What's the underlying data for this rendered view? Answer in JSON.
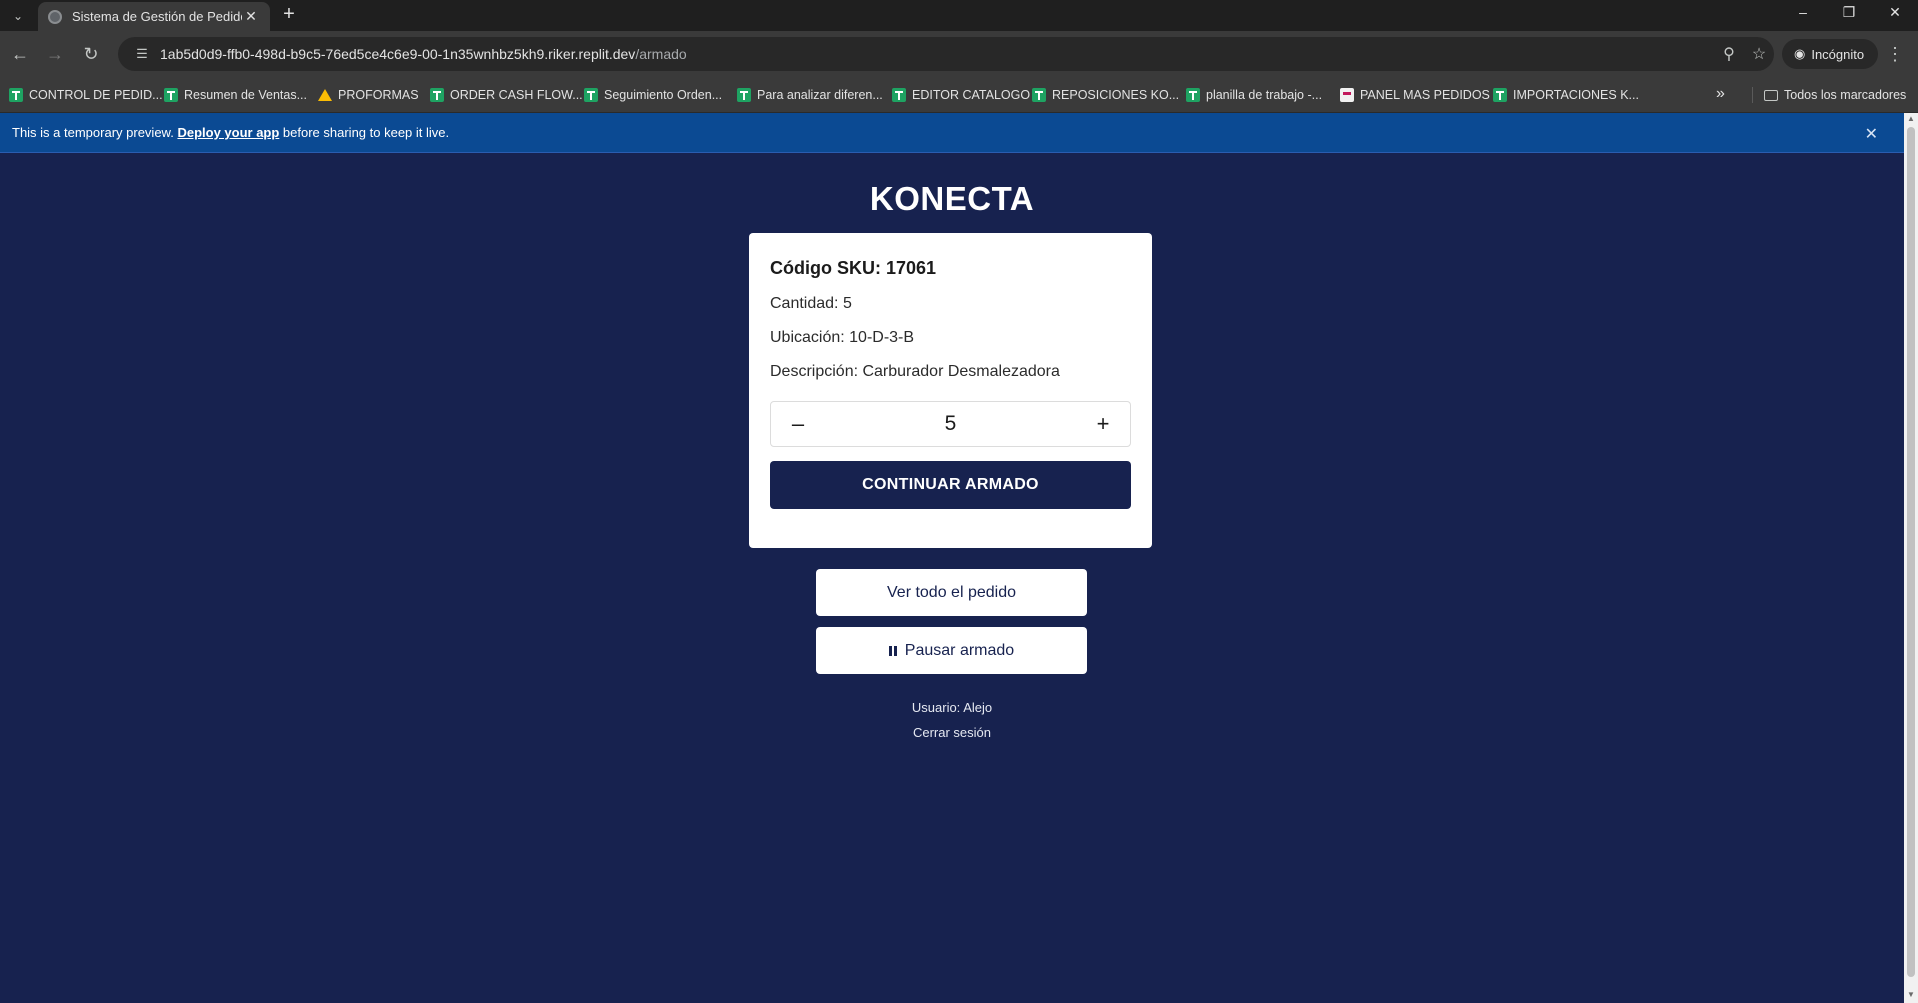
{
  "browser": {
    "tab_title": "Sistema de Gestión de Pedidos",
    "url_host": "1ab5d0d9-ffb0-498d-b9c5-76ed5ce4c6e9-00-1n35wnhbz5kh9.riker.replit.dev",
    "url_path": "/armado",
    "incognito_label": "Incógnito",
    "bookmarks": [
      {
        "label": "CONTROL DE PEDID...",
        "icon": "sheets-icon"
      },
      {
        "label": "Resumen de Ventas...",
        "icon": "sheets-icon"
      },
      {
        "label": "PROFORMAS",
        "icon": "drive-icon"
      },
      {
        "label": "ORDER CASH FLOW...",
        "icon": "sheets-icon"
      },
      {
        "label": "Seguimiento Orden...",
        "icon": "sheets-icon"
      },
      {
        "label": "Para analizar diferen...",
        "icon": "sheets-icon"
      },
      {
        "label": "EDITOR CATALOGO",
        "icon": "sheets-icon"
      },
      {
        "label": "REPOSICIONES KO...",
        "icon": "sheets-icon"
      },
      {
        "label": "planilla de trabajo -...",
        "icon": "sheets-icon"
      },
      {
        "label": "PANEL MAS PEDIDOS",
        "icon": "page-icon"
      },
      {
        "label": "IMPORTACIONES K...",
        "icon": "sheets-icon"
      }
    ],
    "all_bookmarks_label": "Todos los marcadores"
  },
  "banner": {
    "text_before": "This is a temporary preview. ",
    "link": "Deploy your app",
    "text_after": " before sharing to keep it live."
  },
  "app": {
    "title": "KONECTA",
    "item": {
      "sku_line": "Código SKU: 17061",
      "quantity_line": "Cantidad: 5",
      "location_line": "Ubicación: 10-D-3-B",
      "description_line": "Descripción: Carburador Desmalezadora"
    },
    "stepper": {
      "minus": "–",
      "value": "5",
      "plus": "+"
    },
    "continue_label": "CONTINUAR ARMADO",
    "view_order_label": "Ver todo el pedido",
    "pause_label": "Pausar armado",
    "user_line": "Usuario: Alejo",
    "logout_label": "Cerrar sesión"
  },
  "colors": {
    "page_background": "#17224f",
    "banner_background": "#0b4a93",
    "primary_button": "#17224f"
  }
}
